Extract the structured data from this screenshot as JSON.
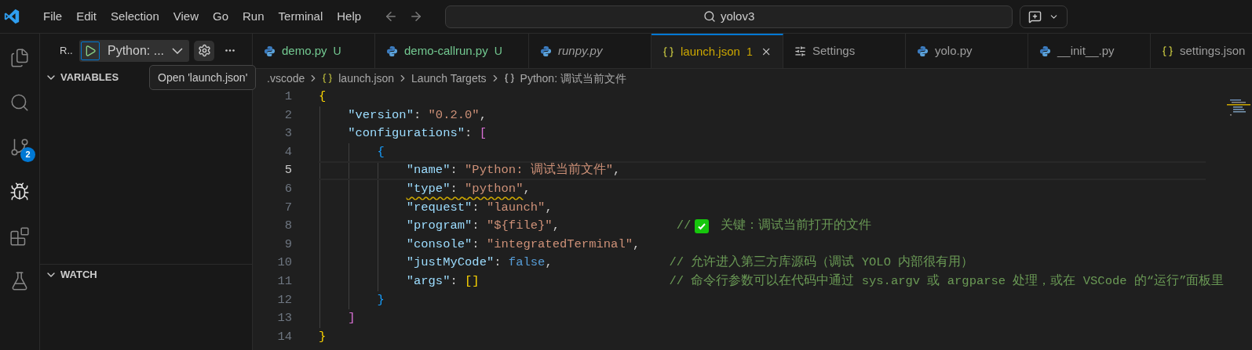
{
  "title_bar": {
    "menu": [
      "File",
      "Edit",
      "Selection",
      "View",
      "Go",
      "Run",
      "Terminal",
      "Help"
    ],
    "search": {
      "value": "yolov3"
    }
  },
  "activity_bar": [
    {
      "kind": "explorer",
      "selected": false
    },
    {
      "kind": "search",
      "selected": false
    },
    {
      "kind": "source-control",
      "selected": false,
      "badge": "2"
    },
    {
      "kind": "run-debug",
      "selected": true
    },
    {
      "kind": "extensions",
      "selected": false
    },
    {
      "kind": "testing",
      "selected": false
    }
  ],
  "sidebar": {
    "title": "R..",
    "configuration": "Python: ...",
    "tooltip": "Open 'launch.json'",
    "sections": [
      {
        "label": "VARIABLES",
        "expanded": true
      },
      {
        "label": "WATCH",
        "expanded": true
      }
    ]
  },
  "tabs": [
    {
      "label": "demo.py",
      "kind": "python",
      "badge": "U",
      "color": "#73c991",
      "preview": false,
      "selected": false
    },
    {
      "label": "demo-callrun.py",
      "kind": "python",
      "badge": "U",
      "color": "#73c991",
      "preview": false,
      "selected": false
    },
    {
      "label": "runpy.py",
      "kind": "python",
      "color": "#9d9d9d",
      "preview": true,
      "selected": false
    },
    {
      "label": "launch.json",
      "kind": "json",
      "badge": "1",
      "color": "#cca700",
      "preview": false,
      "selected": true
    },
    {
      "label": "Settings",
      "kind": "settings",
      "color": "#9d9d9d",
      "preview": false,
      "selected": false
    },
    {
      "label": "yolo.py",
      "kind": "python",
      "color": "#9d9d9d",
      "preview": false,
      "selected": false
    },
    {
      "label": "__init__.py",
      "kind": "python",
      "color": "#9d9d9d",
      "preview": false,
      "selected": false
    },
    {
      "label": "settings.json",
      "kind": "json",
      "color": "#9d9d9d",
      "preview": false,
      "selected": false
    }
  ],
  "breadcrumb": [
    {
      "text": ".vscode",
      "kind": "folder"
    },
    {
      "text": "launch.json",
      "kind": "json"
    },
    {
      "text": "Launch Targets",
      "kind": "section"
    },
    {
      "text": "Python: 调试当前文件",
      "kind": "object"
    }
  ],
  "editor": {
    "lines": [
      {
        "number": "1",
        "current": false,
        "tokens": [
          {
            "kind": "bracket1",
            "text": "{",
            "warning": false
          }
        ]
      },
      {
        "number": "2",
        "current": false,
        "tokens": [
          {
            "kind": "key",
            "text": "    \"version\"",
            "warning": false
          },
          {
            "kind": "punct",
            "text": ": ",
            "warning": false
          },
          {
            "kind": "string",
            "text": "\"0.2.0\"",
            "warning": false
          },
          {
            "kind": "punct",
            "text": ",",
            "warning": false
          }
        ]
      },
      {
        "number": "3",
        "current": false,
        "tokens": [
          {
            "kind": "key",
            "text": "    \"configurations\"",
            "warning": false
          },
          {
            "kind": "punct",
            "text": ": ",
            "warning": false
          },
          {
            "kind": "bracket2",
            "text": "[",
            "warning": false
          }
        ]
      },
      {
        "number": "4",
        "current": false,
        "tokens": [
          {
            "kind": "bracket3",
            "text": "        {",
            "warning": false
          }
        ]
      },
      {
        "number": "5",
        "current": true,
        "tokens": [
          {
            "kind": "key",
            "text": "            \"name\"",
            "warning": false
          },
          {
            "kind": "punct",
            "text": ": ",
            "warning": false
          },
          {
            "kind": "string",
            "text": "\"Python: 调试当前文件\"",
            "warning": false
          },
          {
            "kind": "punct",
            "text": ",",
            "warning": false
          }
        ]
      },
      {
        "number": "6",
        "current": false,
        "tokens": [
          {
            "kind": "key",
            "text": "            \"type\"",
            "warning": true
          },
          {
            "kind": "punct",
            "text": ": ",
            "warning": true
          },
          {
            "kind": "string",
            "text": "\"python\"",
            "warning": true
          },
          {
            "kind": "punct",
            "text": ",",
            "warning": false
          }
        ]
      },
      {
        "number": "7",
        "current": false,
        "tokens": [
          {
            "kind": "key",
            "text": "            \"request\"",
            "warning": false
          },
          {
            "kind": "punct",
            "text": ": ",
            "warning": false
          },
          {
            "kind": "string",
            "text": "\"launch\"",
            "warning": false
          },
          {
            "kind": "punct",
            "text": ",",
            "warning": false
          }
        ]
      },
      {
        "number": "8",
        "current": false,
        "tokens": [
          {
            "kind": "key",
            "text": "            \"program\"",
            "warning": false
          },
          {
            "kind": "punct",
            "text": ": ",
            "warning": false
          },
          {
            "kind": "string",
            "text": "\"${file}\"",
            "warning": false
          },
          {
            "kind": "punct",
            "text": ",",
            "warning": false
          },
          {
            "kind": "comment",
            "text": "                //",
            "warning": false
          },
          {
            "kind": "check"
          },
          {
            "kind": "comment",
            "text": " 关键：调试当前打开的文件",
            "warning": false
          }
        ]
      },
      {
        "number": "9",
        "current": false,
        "tokens": [
          {
            "kind": "key",
            "text": "            \"console\"",
            "warning": false
          },
          {
            "kind": "punct",
            "text": ": ",
            "warning": false
          },
          {
            "kind": "string",
            "text": "\"integratedTerminal\"",
            "warning": false
          },
          {
            "kind": "punct",
            "text": ",",
            "warning": false
          }
        ]
      },
      {
        "number": "10",
        "current": false,
        "tokens": [
          {
            "kind": "key",
            "text": "            \"justMyCode\"",
            "warning": false
          },
          {
            "kind": "punct",
            "text": ": ",
            "warning": false
          },
          {
            "kind": "bool",
            "text": "false",
            "warning": false
          },
          {
            "kind": "punct",
            "text": ",",
            "warning": false
          },
          {
            "kind": "comment",
            "text": "                // 允许进入第三方库源码（调试 YOLO 内部很有用）",
            "warning": false
          }
        ]
      },
      {
        "number": "11",
        "current": false,
        "tokens": [
          {
            "kind": "key",
            "text": "            \"args\"",
            "warning": false
          },
          {
            "kind": "punct",
            "text": ": ",
            "warning": false
          },
          {
            "kind": "bracket1",
            "text": "[]",
            "warning": false
          },
          {
            "kind": "comment",
            "text": "                          // 命令行参数可以在代码中通过 sys.argv 或 argparse 处理，或在 VSCode 的“运行”面板里",
            "warning": false
          }
        ]
      },
      {
        "number": "12",
        "current": false,
        "tokens": [
          {
            "kind": "bracket3",
            "text": "        }",
            "warning": false
          }
        ]
      },
      {
        "number": "13",
        "current": false,
        "tokens": [
          {
            "kind": "bracket2",
            "text": "    ]",
            "warning": false
          }
        ]
      },
      {
        "number": "14",
        "current": false,
        "tokens": [
          {
            "kind": "bracket1",
            "text": "}",
            "warning": false
          }
        ]
      }
    ]
  }
}
